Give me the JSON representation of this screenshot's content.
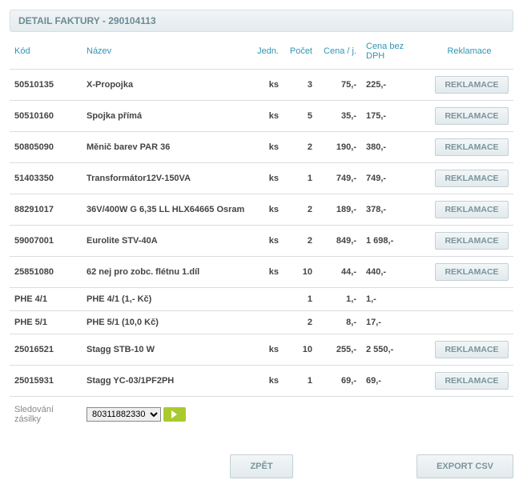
{
  "header": {
    "title_prefix": "DETAIL FAKTURY",
    "invoice_no": "290104113"
  },
  "columns": {
    "kod": "Kód",
    "nazev": "Název",
    "jedn": "Jedn.",
    "pocet": "Počet",
    "cenaj": "Cena / j.",
    "cenabez": "Cena bez DPH",
    "reklamace": "Reklamace"
  },
  "buttons": {
    "reklamace": "REKLAMACE",
    "zpet": "ZPĚT",
    "export": "EXPORT CSV"
  },
  "tracking": {
    "label": "Sledování zásilky",
    "selected": "80311882330"
  },
  "rows": [
    {
      "kod": "50510135",
      "nazev": "X-Propojka",
      "jedn": "ks",
      "pocet": "3",
      "cenaj": "75,-",
      "cenabez": "225,-",
      "rekl": true
    },
    {
      "kod": "50510160",
      "nazev": "Spojka přímá",
      "jedn": "ks",
      "pocet": "5",
      "cenaj": "35,-",
      "cenabez": "175,-",
      "rekl": true
    },
    {
      "kod": "50805090",
      "nazev": "Měnič barev PAR 36",
      "jedn": "ks",
      "pocet": "2",
      "cenaj": "190,-",
      "cenabez": "380,-",
      "rekl": true
    },
    {
      "kod": "51403350",
      "nazev": "Transformátor12V-150VA",
      "jedn": "ks",
      "pocet": "1",
      "cenaj": "749,-",
      "cenabez": "749,-",
      "rekl": true
    },
    {
      "kod": "88291017",
      "nazev": "36V/400W G 6,35 LL HLX64665 Osram",
      "jedn": "ks",
      "pocet": "2",
      "cenaj": "189,-",
      "cenabez": "378,-",
      "rekl": true
    },
    {
      "kod": "59007001",
      "nazev": "Eurolite STV-40A",
      "jedn": "ks",
      "pocet": "2",
      "cenaj": "849,-",
      "cenabez": "1 698,-",
      "rekl": true
    },
    {
      "kod": "25851080",
      "nazev": "62 nej pro zobc. flétnu 1.díl",
      "jedn": "ks",
      "pocet": "10",
      "cenaj": "44,-",
      "cenabez": "440,-",
      "rekl": true
    },
    {
      "kod": "PHE 4/1",
      "nazev": "PHE 4/1 (1,- Kč)",
      "jedn": "",
      "pocet": "1",
      "cenaj": "1,-",
      "cenabez": "1,-",
      "rekl": false
    },
    {
      "kod": "PHE 5/1",
      "nazev": "PHE 5/1 (10,0 Kč)",
      "jedn": "",
      "pocet": "2",
      "cenaj": "8,-",
      "cenabez": "17,-",
      "rekl": false
    },
    {
      "kod": "25016521",
      "nazev": "Stagg STB-10 W",
      "jedn": "ks",
      "pocet": "10",
      "cenaj": "255,-",
      "cenabez": "2 550,-",
      "rekl": true
    },
    {
      "kod": "25015931",
      "nazev": "Stagg YC-03/1PF2PH",
      "jedn": "ks",
      "pocet": "1",
      "cenaj": "69,-",
      "cenabez": "69,-",
      "rekl": true
    }
  ]
}
